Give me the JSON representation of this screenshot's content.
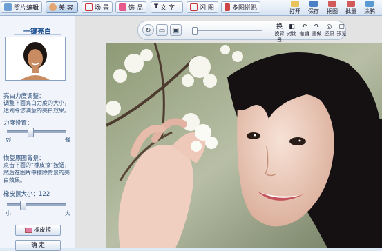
{
  "toolbar": {
    "tabs": [
      {
        "label": "照片编辑",
        "active": false,
        "icon": "photo-edit-icon"
      },
      {
        "label": "美 容",
        "active": true,
        "icon": "beauty-face-icon"
      },
      {
        "label": "场 景",
        "active": false,
        "icon": "scene-icon"
      },
      {
        "label": "饰 品",
        "active": false,
        "icon": "bow-icon"
      },
      {
        "label": "文 字",
        "active": false,
        "icon": "text-icon"
      },
      {
        "label": "闪 图",
        "active": false,
        "icon": "flash-icon"
      },
      {
        "label": "多图拼贴",
        "active": false,
        "icon": "collage-icon"
      }
    ],
    "actions": [
      {
        "label": "打开",
        "icon": "open-folder-icon"
      },
      {
        "label": "保存",
        "icon": "save-icon"
      },
      {
        "label": "抠图",
        "icon": "cutout-icon"
      },
      {
        "label": "批量",
        "icon": "batch-icon"
      },
      {
        "label": "涂鸦",
        "icon": "doodle-icon"
      }
    ]
  },
  "left_panel": {
    "title": "一键亮白",
    "strength_label": "亮白力度调整：",
    "strength_desc": "调整下面亮白力度的大小，达到令您满意的亮白效果。",
    "strength_setting_label": "力度设置：",
    "strength_value": 0.38,
    "weak_label": "弱",
    "strong_label": "强",
    "restore_label": "恢复原图背景：",
    "restore_desc": "点击下面的“橡皮擦”按钮，然后在图片中擦除背景的亮白效果。",
    "eraser_size_label": "橡皮擦大小：",
    "eraser_size_value": "122",
    "eraser_fraction": 0.24,
    "small_label": "小",
    "large_label": "大",
    "eraser_button": "橡皮擦",
    "confirm_button": "确 定"
  },
  "image_toolbar": {
    "zoom_value": 0.0,
    "tools": [
      {
        "label": "换背景",
        "glyph": "换"
      },
      {
        "label": "对比",
        "glyph": "◧"
      },
      {
        "label": "撤销",
        "glyph": "↶"
      },
      {
        "label": "重做",
        "glyph": "↷"
      },
      {
        "label": "还原",
        "glyph": "◎"
      },
      {
        "label": "预览",
        "glyph": "▢"
      }
    ]
  },
  "colors": {
    "accent": "#1d4f91",
    "panel_bg": "#f1f5fb",
    "toolbar_border": "#9db5d3"
  }
}
